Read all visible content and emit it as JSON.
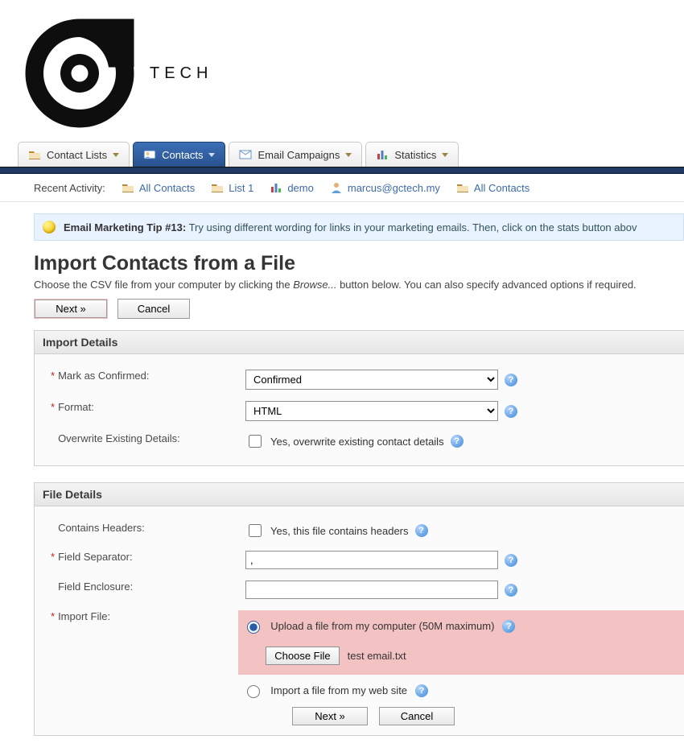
{
  "brand": {
    "name": "TECH"
  },
  "tabs": [
    {
      "label": "Contact Lists"
    },
    {
      "label": "Contacts"
    },
    {
      "label": "Email Campaigns"
    },
    {
      "label": "Statistics"
    }
  ],
  "active_tab_index": 1,
  "recent": {
    "label": "Recent Activity:",
    "items": [
      {
        "icon": "contacts",
        "label": "All Contacts"
      },
      {
        "icon": "contacts",
        "label": "List 1"
      },
      {
        "icon": "bar",
        "label": "demo"
      },
      {
        "icon": "user",
        "label": "marcus@gctech.my"
      },
      {
        "icon": "contacts",
        "label": "All Contacts"
      }
    ]
  },
  "tip": {
    "heading": "Email Marketing Tip #13:",
    "text": "Try using different wording for links in your marketing emails. Then, click on the stats button abov"
  },
  "page": {
    "title": "Import Contacts from a File",
    "desc_pre": "Choose the CSV file from your computer by clicking the ",
    "desc_em": "Browse...",
    "desc_post": " button below. You can also specify advanced options if required."
  },
  "buttons": {
    "next": "Next »",
    "cancel": "Cancel",
    "choose_file": "Choose File"
  },
  "panels": {
    "import_details": "Import Details",
    "file_details": "File Details"
  },
  "fields": {
    "mark_confirmed": {
      "label": "Mark as Confirmed:",
      "value": "Confirmed"
    },
    "format": {
      "label": "Format:",
      "value": "HTML"
    },
    "overwrite": {
      "label": "Overwrite Existing Details:",
      "checkbox_label": "Yes, overwrite existing contact details"
    },
    "contains_headers": {
      "label": "Contains Headers:",
      "checkbox_label": "Yes, this file contains headers"
    },
    "field_separator": {
      "label": "Field Separator:",
      "value": ","
    },
    "field_enclosure": {
      "label": "Field Enclosure:",
      "value": ""
    },
    "import_file": {
      "label": "Import File:",
      "opt_upload": "Upload a file from my computer (50M maximum)",
      "file_name": "test email.txt",
      "opt_web": "Import a file from my web site"
    }
  }
}
